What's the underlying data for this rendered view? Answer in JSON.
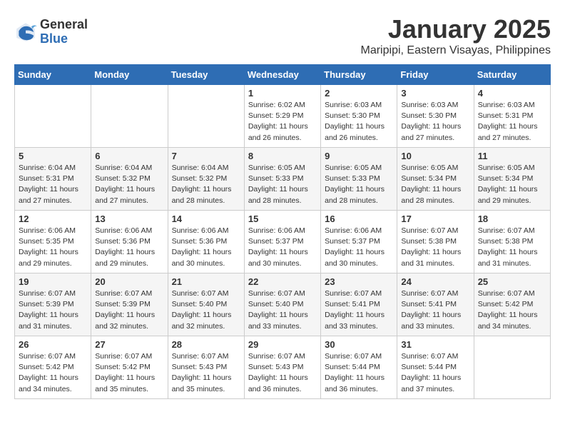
{
  "logo": {
    "general": "General",
    "blue": "Blue"
  },
  "title": "January 2025",
  "subtitle": "Maripipi, Eastern Visayas, Philippines",
  "headers": [
    "Sunday",
    "Monday",
    "Tuesday",
    "Wednesday",
    "Thursday",
    "Friday",
    "Saturday"
  ],
  "weeks": [
    [
      {
        "day": "",
        "info": ""
      },
      {
        "day": "",
        "info": ""
      },
      {
        "day": "",
        "info": ""
      },
      {
        "day": "1",
        "info": "Sunrise: 6:02 AM\nSunset: 5:29 PM\nDaylight: 11 hours and 26 minutes."
      },
      {
        "day": "2",
        "info": "Sunrise: 6:03 AM\nSunset: 5:30 PM\nDaylight: 11 hours and 26 minutes."
      },
      {
        "day": "3",
        "info": "Sunrise: 6:03 AM\nSunset: 5:30 PM\nDaylight: 11 hours and 27 minutes."
      },
      {
        "day": "4",
        "info": "Sunrise: 6:03 AM\nSunset: 5:31 PM\nDaylight: 11 hours and 27 minutes."
      }
    ],
    [
      {
        "day": "5",
        "info": "Sunrise: 6:04 AM\nSunset: 5:31 PM\nDaylight: 11 hours and 27 minutes."
      },
      {
        "day": "6",
        "info": "Sunrise: 6:04 AM\nSunset: 5:32 PM\nDaylight: 11 hours and 27 minutes."
      },
      {
        "day": "7",
        "info": "Sunrise: 6:04 AM\nSunset: 5:32 PM\nDaylight: 11 hours and 28 minutes."
      },
      {
        "day": "8",
        "info": "Sunrise: 6:05 AM\nSunset: 5:33 PM\nDaylight: 11 hours and 28 minutes."
      },
      {
        "day": "9",
        "info": "Sunrise: 6:05 AM\nSunset: 5:33 PM\nDaylight: 11 hours and 28 minutes."
      },
      {
        "day": "10",
        "info": "Sunrise: 6:05 AM\nSunset: 5:34 PM\nDaylight: 11 hours and 28 minutes."
      },
      {
        "day": "11",
        "info": "Sunrise: 6:05 AM\nSunset: 5:34 PM\nDaylight: 11 hours and 29 minutes."
      }
    ],
    [
      {
        "day": "12",
        "info": "Sunrise: 6:06 AM\nSunset: 5:35 PM\nDaylight: 11 hours and 29 minutes."
      },
      {
        "day": "13",
        "info": "Sunrise: 6:06 AM\nSunset: 5:36 PM\nDaylight: 11 hours and 29 minutes."
      },
      {
        "day": "14",
        "info": "Sunrise: 6:06 AM\nSunset: 5:36 PM\nDaylight: 11 hours and 30 minutes."
      },
      {
        "day": "15",
        "info": "Sunrise: 6:06 AM\nSunset: 5:37 PM\nDaylight: 11 hours and 30 minutes."
      },
      {
        "day": "16",
        "info": "Sunrise: 6:06 AM\nSunset: 5:37 PM\nDaylight: 11 hours and 30 minutes."
      },
      {
        "day": "17",
        "info": "Sunrise: 6:07 AM\nSunset: 5:38 PM\nDaylight: 11 hours and 31 minutes."
      },
      {
        "day": "18",
        "info": "Sunrise: 6:07 AM\nSunset: 5:38 PM\nDaylight: 11 hours and 31 minutes."
      }
    ],
    [
      {
        "day": "19",
        "info": "Sunrise: 6:07 AM\nSunset: 5:39 PM\nDaylight: 11 hours and 31 minutes."
      },
      {
        "day": "20",
        "info": "Sunrise: 6:07 AM\nSunset: 5:39 PM\nDaylight: 11 hours and 32 minutes."
      },
      {
        "day": "21",
        "info": "Sunrise: 6:07 AM\nSunset: 5:40 PM\nDaylight: 11 hours and 32 minutes."
      },
      {
        "day": "22",
        "info": "Sunrise: 6:07 AM\nSunset: 5:40 PM\nDaylight: 11 hours and 33 minutes."
      },
      {
        "day": "23",
        "info": "Sunrise: 6:07 AM\nSunset: 5:41 PM\nDaylight: 11 hours and 33 minutes."
      },
      {
        "day": "24",
        "info": "Sunrise: 6:07 AM\nSunset: 5:41 PM\nDaylight: 11 hours and 33 minutes."
      },
      {
        "day": "25",
        "info": "Sunrise: 6:07 AM\nSunset: 5:42 PM\nDaylight: 11 hours and 34 minutes."
      }
    ],
    [
      {
        "day": "26",
        "info": "Sunrise: 6:07 AM\nSunset: 5:42 PM\nDaylight: 11 hours and 34 minutes."
      },
      {
        "day": "27",
        "info": "Sunrise: 6:07 AM\nSunset: 5:42 PM\nDaylight: 11 hours and 35 minutes."
      },
      {
        "day": "28",
        "info": "Sunrise: 6:07 AM\nSunset: 5:43 PM\nDaylight: 11 hours and 35 minutes."
      },
      {
        "day": "29",
        "info": "Sunrise: 6:07 AM\nSunset: 5:43 PM\nDaylight: 11 hours and 36 minutes."
      },
      {
        "day": "30",
        "info": "Sunrise: 6:07 AM\nSunset: 5:44 PM\nDaylight: 11 hours and 36 minutes."
      },
      {
        "day": "31",
        "info": "Sunrise: 6:07 AM\nSunset: 5:44 PM\nDaylight: 11 hours and 37 minutes."
      },
      {
        "day": "",
        "info": ""
      }
    ]
  ]
}
